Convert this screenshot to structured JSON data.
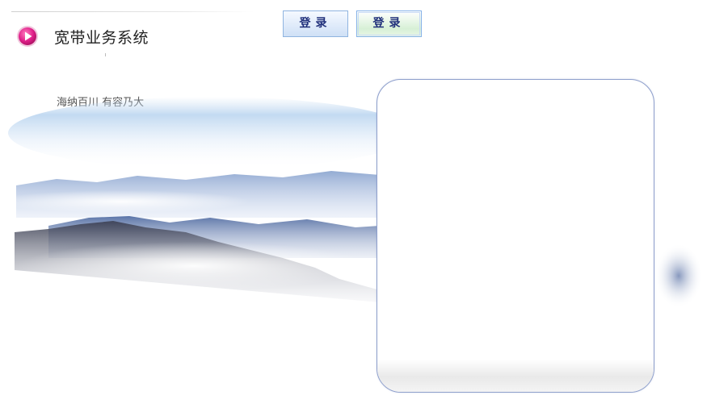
{
  "header": {
    "title": "宽带业务系统",
    "icon": "play-circle-icon",
    "icon_color": "#d4147a"
  },
  "slogan": "海纳百川  有容乃大",
  "buttons": [
    {
      "label": "登录"
    },
    {
      "label": "登录"
    }
  ],
  "colors": {
    "button_text": "#1f2f7a",
    "panel_border": "#8e9fcc"
  }
}
